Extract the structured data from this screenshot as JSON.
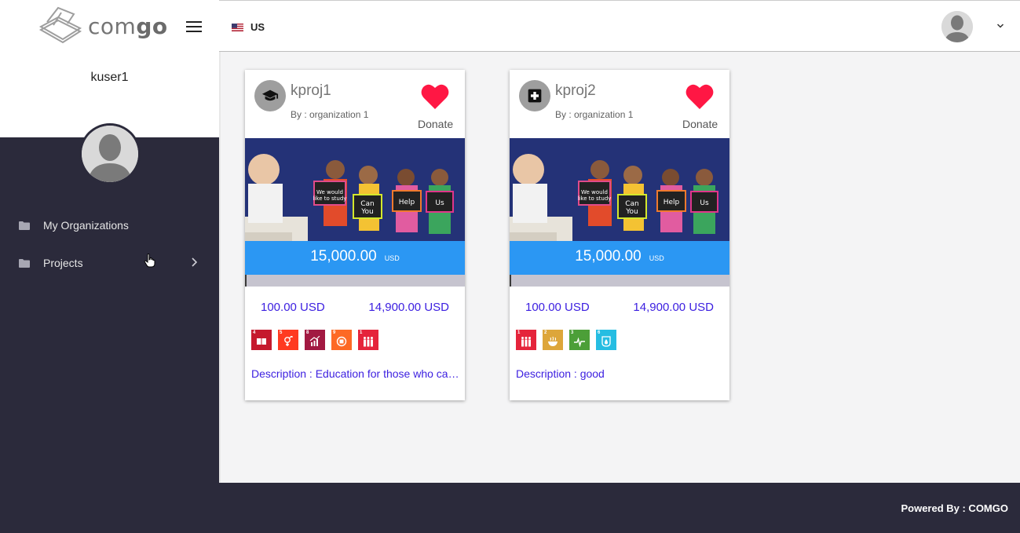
{
  "brand": {
    "name_light": "com",
    "name_bold": "go"
  },
  "sidebar": {
    "username": "kuser1",
    "items": [
      {
        "label": "My Organizations",
        "icon": "folder-icon"
      },
      {
        "label": "Projects",
        "icon": "folder-icon",
        "has_submenu": true
      }
    ]
  },
  "header": {
    "language": "US"
  },
  "footer": {
    "text": "Powered By : COMGO"
  },
  "colors": {
    "sidebar_bg": "#2b2a3b",
    "amount_bar": "#2b97f3",
    "link_text": "#3b1ee0",
    "heart": "#ff1744"
  },
  "projects": [
    {
      "title": "kproj1",
      "by": "By : organization 1",
      "category_icon": "graduation-cap-icon",
      "donate_label": "Donate",
      "goal": "15,000.00",
      "currency": "USD",
      "raised": "100.00 USD",
      "remaining": "14,900.00 USD",
      "progress": 0.0067,
      "sdgs": [
        {
          "number": "4",
          "color": "#c5192d",
          "icon": "book-icon"
        },
        {
          "number": "5",
          "color": "#ff3a21",
          "icon": "gender-icon"
        },
        {
          "number": "8",
          "color": "#a21942",
          "icon": "growth-chart-icon"
        },
        {
          "number": "9",
          "color": "#fd6925",
          "icon": "cubes-icon"
        },
        {
          "number": "1",
          "color": "#e5243b",
          "icon": "family-icon"
        }
      ],
      "description": "Description : Education for those who can't afford it"
    },
    {
      "title": "kproj2",
      "by": "By : organization 1",
      "category_icon": "medical-cross-icon",
      "donate_label": "Donate",
      "goal": "15,000.00",
      "currency": "USD",
      "raised": "100.00 USD",
      "remaining": "14,900.00 USD",
      "progress": 0.0067,
      "sdgs": [
        {
          "number": "1",
          "color": "#e5243b",
          "icon": "family-icon"
        },
        {
          "number": "2",
          "color": "#dda63a",
          "icon": "bowl-icon"
        },
        {
          "number": "3",
          "color": "#4c9f38",
          "icon": "heartbeat-icon"
        },
        {
          "number": "6",
          "color": "#26bde2",
          "icon": "water-drop-icon"
        }
      ],
      "description": "Description : good"
    }
  ]
}
